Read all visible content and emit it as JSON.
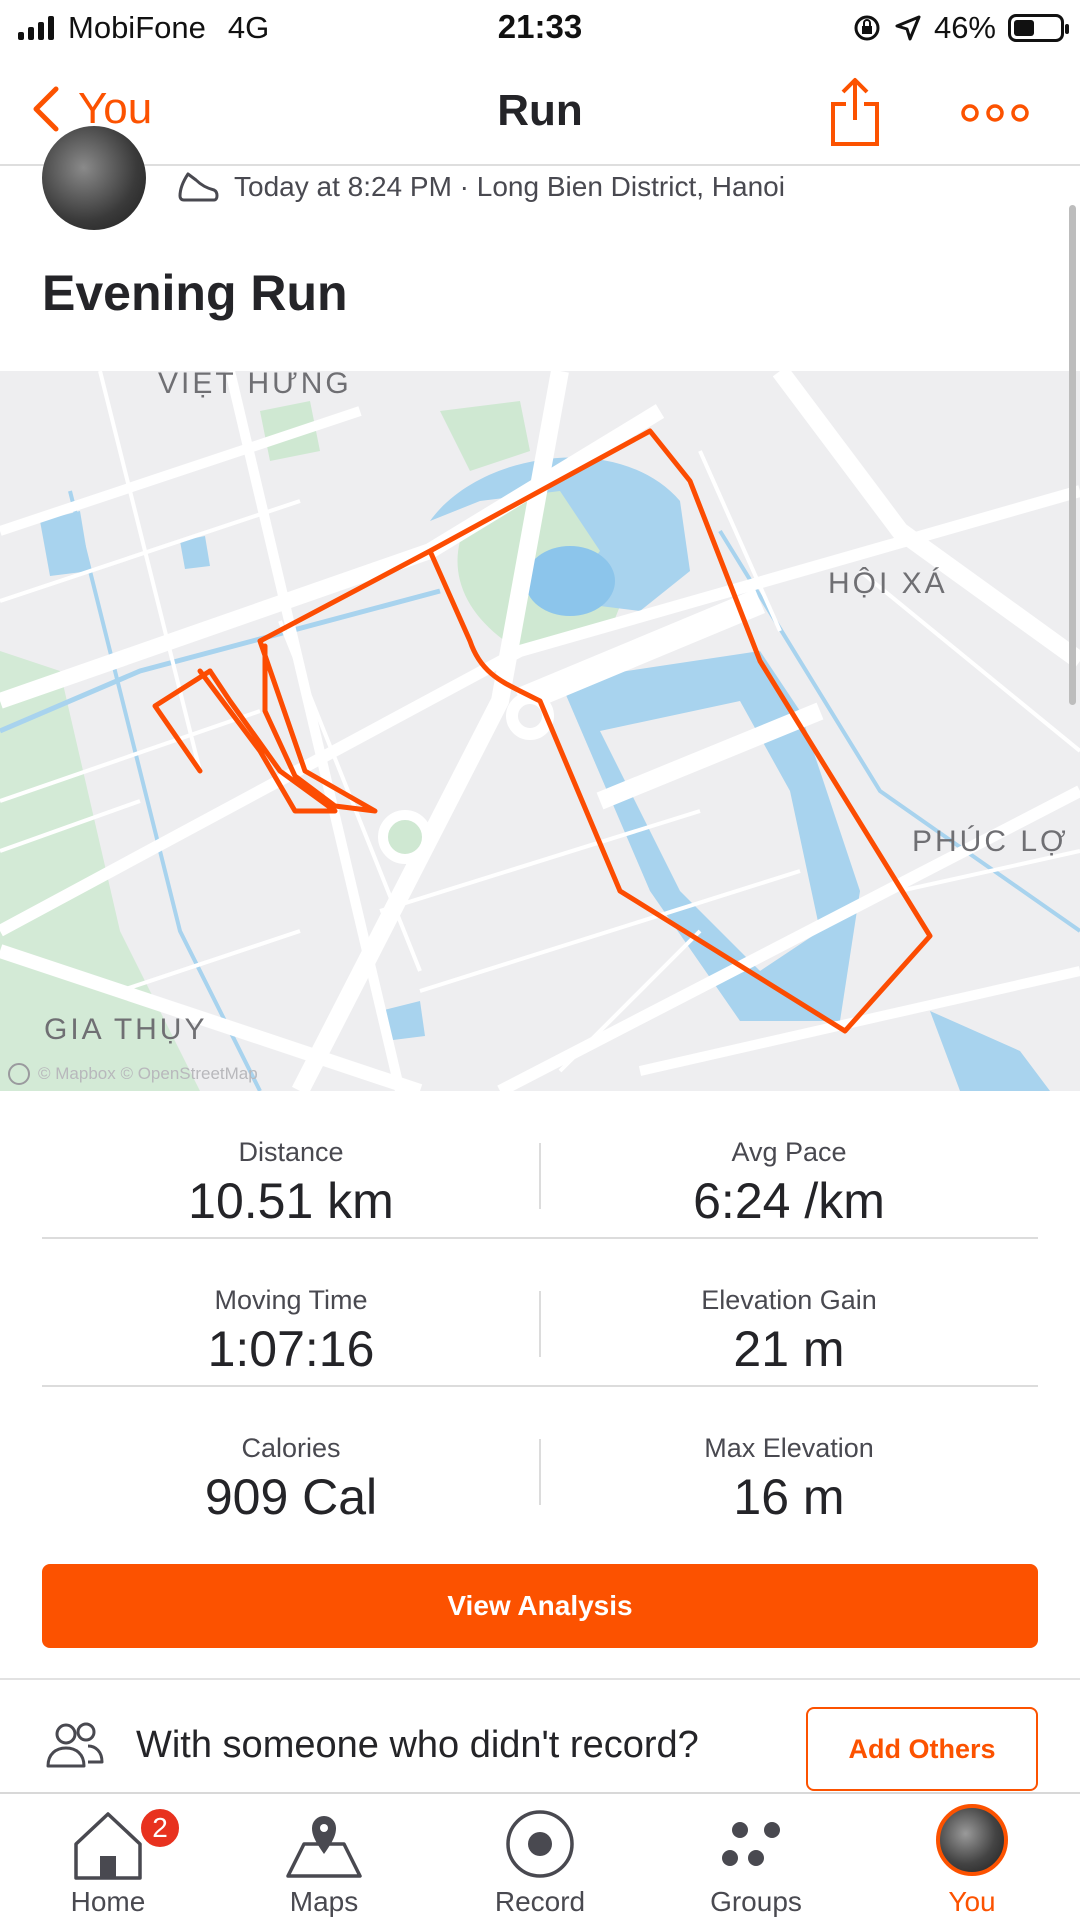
{
  "status_bar": {
    "carrier": "MobiFone",
    "network": "4G",
    "time": "21:33",
    "battery": "46%",
    "battery_level": 0.46
  },
  "nav": {
    "back_label": "You",
    "title": "Run",
    "share_icon": "share-icon",
    "more_icon": "more-icon"
  },
  "header": {
    "meta": "Today at 8:24 PM · Long Bien District, Hanoi",
    "activity_title": "Evening Run"
  },
  "map": {
    "labels": {
      "viet_hung": "VIỆT HƯNG",
      "hoi_xa": "HỘI XÁ",
      "phuc_loi": "PHÚC LỢ",
      "gia_thuy": "GIA THỤY"
    },
    "attribution": "© Mapbox © OpenStreetMap",
    "route_color": "#fc4c02"
  },
  "stats": {
    "distance_label": "Distance",
    "distance_value": "10.51 km",
    "avg_pace_label": "Avg Pace",
    "avg_pace_value": "6:24 /km",
    "moving_time_label": "Moving Time",
    "moving_time_value": "1:07:16",
    "elevation_gain_label": "Elevation Gain",
    "elevation_gain_value": "21 m",
    "calories_label": "Calories",
    "calories_value": "909 Cal",
    "max_elevation_label": "Max Elevation",
    "max_elevation_value": "16 m"
  },
  "actions": {
    "view_analysis": "View Analysis",
    "others_prompt": "With someone who didn't record?",
    "add_others": "Add Others"
  },
  "tab_bar": {
    "home": "Home",
    "home_badge": "2",
    "maps": "Maps",
    "record": "Record",
    "groups": "Groups",
    "you": "You"
  },
  "colors": {
    "accent": "#fc5200",
    "badge": "#e8321f"
  }
}
